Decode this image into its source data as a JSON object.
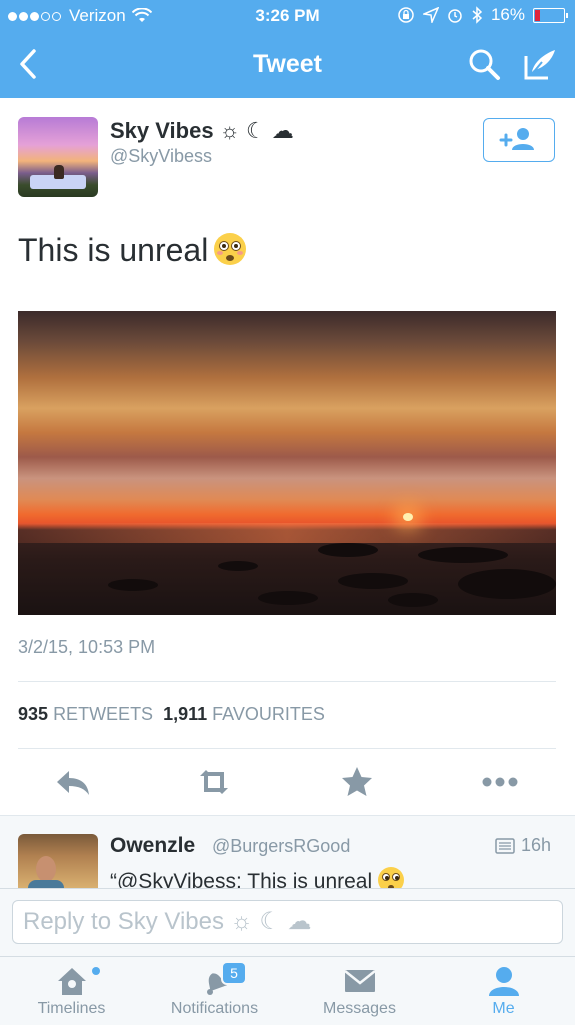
{
  "status_bar": {
    "carrier": "Verizon",
    "time": "3:26 PM",
    "battery": "16%"
  },
  "nav": {
    "title": "Tweet"
  },
  "tweet": {
    "author_name": "Sky Vibes ☼ ☾ ☁",
    "author_handle": "@SkyVibess",
    "text": "This is unreal",
    "timestamp": "3/2/15, 10:53 PM",
    "retweets_count": "935",
    "retweets_label": "RETWEETS",
    "favourites_count": "1,911",
    "favourites_label": "FAVOURITES"
  },
  "reply": {
    "author_name": "Owenzle",
    "author_handle": "@BurgersRGood",
    "time": "16h",
    "text": "“@SkyVibess: This is unreal"
  },
  "reply_input": {
    "placeholder": "Reply to Sky Vibes ☼ ☾ ☁"
  },
  "tabs": [
    {
      "label": "Timelines"
    },
    {
      "label": "Notifications",
      "badge": "5"
    },
    {
      "label": "Messages"
    },
    {
      "label": "Me"
    }
  ],
  "colors": {
    "brand": "#55acee",
    "text": "#292f33",
    "muted": "#8899a6",
    "battery_low": "#e0243b"
  },
  "icons": [
    "back-icon",
    "search-icon",
    "compose-icon",
    "follow-icon",
    "reply-icon",
    "retweet-icon",
    "favourite-icon",
    "more-icon",
    "home-icon",
    "bell-icon",
    "envelope-icon",
    "person-icon",
    "wifi-icon",
    "lock-rotation-icon",
    "location-icon",
    "alarm-icon",
    "bluetooth-icon",
    "battery-icon"
  ]
}
